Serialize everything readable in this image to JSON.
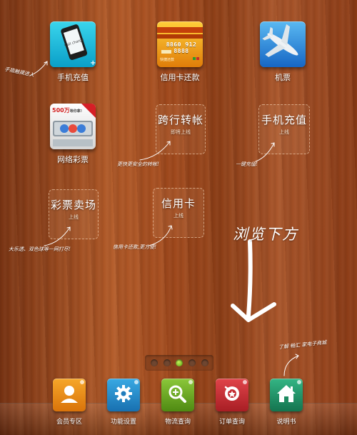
{
  "apps": [
    {
      "id": "phone-recharge",
      "label": "手机充值",
      "screen_text": "Call charge"
    },
    {
      "id": "credit-card-repay",
      "label": "信用卡还款",
      "card_number": "8860 912 8888",
      "card_holder": "快捷还款"
    },
    {
      "id": "flight-tickets",
      "label": "机票"
    },
    {
      "id": "online-lottery",
      "label": "网络彩票",
      "promo": "500万",
      "promo_suffix": "等你拿!"
    }
  ],
  "placeholders": [
    {
      "title": "跨行转帐",
      "sub": "即将上线"
    },
    {
      "title": "手机充值",
      "sub": "上线"
    },
    {
      "title": "彩票卖场",
      "sub": "上线"
    },
    {
      "title": "信用卡",
      "sub": "上线"
    }
  ],
  "hints": {
    "hint1": "手指触摸进入",
    "hint2": "更快更安全的转帐!",
    "hint3": "一键充值!",
    "hint4": "大乐透、双色球等一网打尽!",
    "hint5": "信用卡还款,更方便!",
    "hint6": "了解 畅汇 家电子商城"
  },
  "browse_text": "浏览下方",
  "pager": {
    "count": 5,
    "active_index": 2
  },
  "dock": [
    {
      "id": "member",
      "label": "会员专区",
      "color": "#e98a10"
    },
    {
      "id": "settings",
      "label": "功能设置",
      "color": "#1e90c9"
    },
    {
      "id": "logistics",
      "label": "物流查询",
      "color": "#68a51a"
    },
    {
      "id": "orders",
      "label": "订单查询",
      "color": "#c42c32"
    },
    {
      "id": "manual",
      "label": "说明书",
      "color": "#1f9a6a"
    }
  ]
}
